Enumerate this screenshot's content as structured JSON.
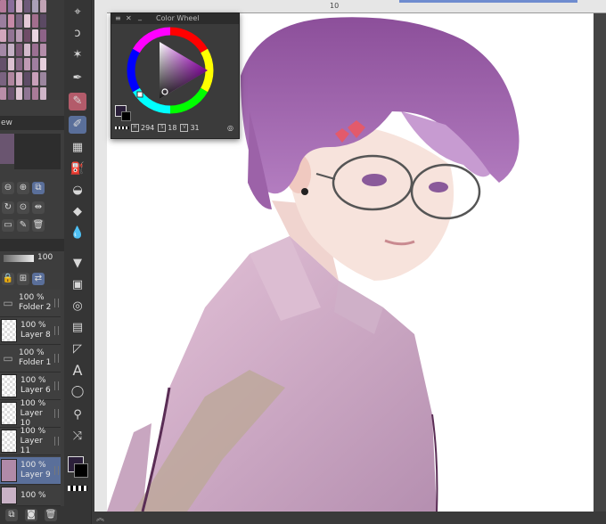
{
  "color_wheel": {
    "title": "Color Wheel",
    "hue": "294",
    "saturation": "18",
    "brightness": "31",
    "h_label": "H",
    "s_label": "S",
    "v_label": "V",
    "main_color": "#2b1f3a"
  },
  "ruler": {
    "mark": "10"
  },
  "left_panel": {
    "navigator_tab": "ew",
    "opacity_value": "100",
    "layers": [
      {
        "opacity": "100 %",
        "name": "Folder 2",
        "type": "folder"
      },
      {
        "opacity": "100 %",
        "name": "Layer 8",
        "type": "layer"
      },
      {
        "opacity": "100 %",
        "name": "Folder 1",
        "type": "folder"
      },
      {
        "opacity": "100 %",
        "name": "Layer 6",
        "type": "layer"
      },
      {
        "opacity": "100 %",
        "name": "Layer 10",
        "type": "layer"
      },
      {
        "opacity": "100 %",
        "name": "Layer 11",
        "type": "layer"
      },
      {
        "opacity": "100 %",
        "name": "Layer 9",
        "type": "layer",
        "selected": true
      },
      {
        "opacity": "100 %",
        "name": "",
        "type": "layer"
      }
    ]
  },
  "toolbar": {
    "tools": [
      "zoom-icon",
      "move-icon",
      "lasso-icon",
      "auto-select-icon",
      "pen-icon",
      "eraser-pen-icon",
      "brush-icon",
      "grid-icon",
      "airbrush-icon",
      "blend-icon",
      "erase-icon",
      "fill-icon",
      "gradient-icon",
      "text-icon",
      "balloon-icon",
      "eyedropper-icon",
      "correction-icon"
    ]
  },
  "text_tool_glyph": "A"
}
